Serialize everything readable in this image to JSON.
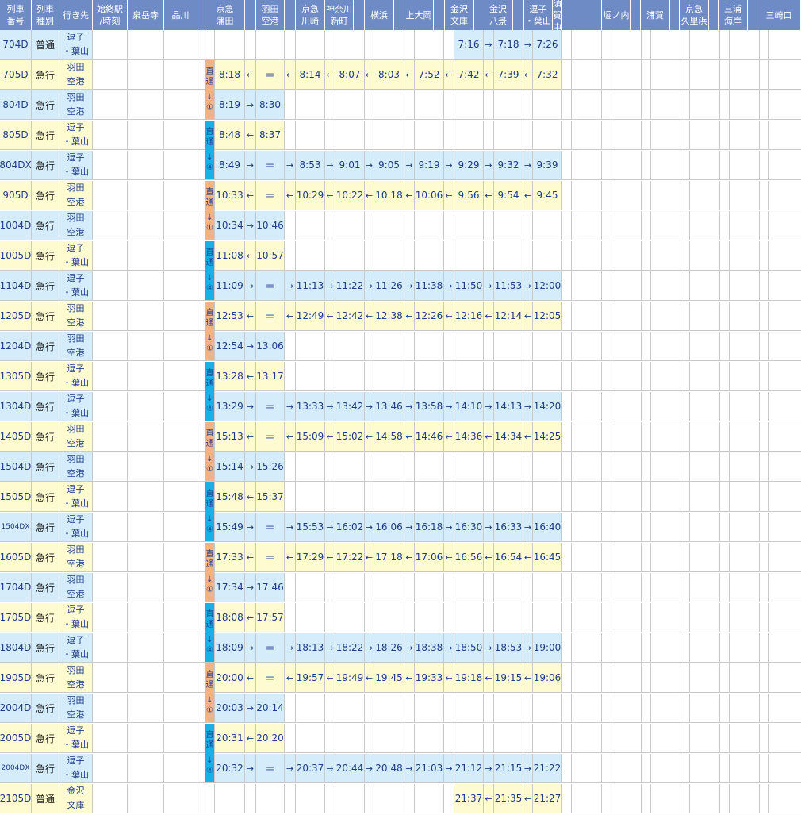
{
  "headers": [
    "列車\n番号",
    "列車\n種別",
    "行き先",
    "始終駅\n/時刻",
    "泉岳寺",
    "品川",
    "",
    "京急\n蒲田",
    "",
    "羽田\n空港",
    "",
    "京急\n川崎",
    "神奈川\n新町",
    "",
    "横浜",
    "",
    "上大岡",
    "",
    "金沢\n文庫",
    "",
    "金沢\n八景",
    "",
    "逗子\n・葉山",
    "横須賀\n中央",
    "",
    "堀ノ内",
    "",
    "浦賀",
    "",
    "京急\n久里浜",
    "",
    "三浦\n海岸",
    "",
    "三崎口"
  ],
  "through_labels": {
    "top": "直\n通",
    "bottom": "↓\n①",
    "bottom_alt": "↓\n④"
  },
  "equal_mark": "＝",
  "trains": [
    {
      "id": "704D",
      "kind": "普通",
      "dest": "逗子\n・葉山",
      "color": "blue",
      "times": {
        "kanazawa_bunko": "7:16",
        "a_kb_kh": "→",
        "kanazawa_hakkei": "7:18",
        "a_kh_zushi": "→",
        "zushi": "7:26"
      }
    },
    {
      "id": "705D",
      "kind": "急行",
      "dest": "羽田\n空港",
      "color": "yellow",
      "through": "top",
      "times": {
        "keikyu_kamata": "8:18",
        "a_kamata_haneda": "←",
        "haneda": "＝",
        "a_haneda_kawasaki": "←",
        "keikyu_kawasaki": "8:14",
        "a_kaw_kanagawa": "←",
        "kanagawa_shinmachi": "8:07",
        "a_kan_yoko": "←",
        "yokohama": "8:03",
        "a_yoko_kamiooka": "←",
        "kamiooka": "7:52",
        "a_kami_kb": "←",
        "kanazawa_bunko": "7:42",
        "a_kb_kh": "←",
        "kanazawa_hakkei": "7:39",
        "a_kh_zushi": "←",
        "zushi": "7:32"
      }
    },
    {
      "id": "804D",
      "kind": "急行",
      "dest": "羽田\n空港",
      "color": "blue",
      "times": {
        "keikyu_kamata": "8:19",
        "a_kamata_haneda": "→",
        "haneda": "8:30"
      }
    },
    {
      "id": "805D",
      "kind": "急行",
      "dest": "逗子\n・葉山",
      "color": "yellow",
      "through": "top",
      "times": {
        "keikyu_kamata": "8:48",
        "a_kamata_haneda": "←",
        "haneda": "8:37"
      }
    },
    {
      "id": "804DX",
      "kind": "急行",
      "dest": "逗子\n・葉山",
      "color": "blue",
      "times": {
        "keikyu_kamata": "8:49",
        "a_kamata_haneda": "→",
        "haneda": "＝",
        "a_haneda_kawasaki": "→",
        "keikyu_kawasaki": "8:53",
        "a_kaw_kanagawa": "→",
        "kanagawa_shinmachi": "9:01",
        "a_kan_yoko": "→",
        "yokohama": "9:05",
        "a_yoko_kamiooka": "→",
        "kamiooka": "9:19",
        "a_kami_kb": "→",
        "kanazawa_bunko": "9:29",
        "a_kb_kh": "→",
        "kanazawa_hakkei": "9:32",
        "a_kh_zushi": "→",
        "zushi": "9:39"
      }
    },
    {
      "id": "905D",
      "kind": "急行",
      "dest": "羽田\n空港",
      "color": "yellow",
      "through": "top",
      "times": {
        "keikyu_kamata": "10:33",
        "a_kamata_haneda": "←",
        "haneda": "＝",
        "a_haneda_kawasaki": "←",
        "keikyu_kawasaki": "10:29",
        "a_kaw_kanagawa": "←",
        "kanagawa_shinmachi": "10:22",
        "a_kan_yoko": "←",
        "yokohama": "10:18",
        "a_yoko_kamiooka": "←",
        "kamiooka": "10:06",
        "a_kami_kb": "←",
        "kanazawa_bunko": "9:56",
        "a_kb_kh": "←",
        "kanazawa_hakkei": "9:54",
        "a_kh_zushi": "←",
        "zushi": "9:45"
      }
    },
    {
      "id": "1004D",
      "kind": "急行",
      "dest": "羽田\n空港",
      "color": "blue",
      "times": {
        "keikyu_kamata": "10:34",
        "a_kamata_haneda": "→",
        "haneda": "10:46"
      }
    },
    {
      "id": "1005D",
      "kind": "急行",
      "dest": "逗子\n・葉山",
      "color": "yellow",
      "through": "top",
      "times": {
        "keikyu_kamata": "11:08",
        "a_kamata_haneda": "←",
        "haneda": "10:57"
      }
    },
    {
      "id": "1104D",
      "kind": "急行",
      "dest": "逗子\n・葉山",
      "color": "blue",
      "times": {
        "keikyu_kamata": "11:09",
        "a_kamata_haneda": "→",
        "haneda": "＝",
        "a_haneda_kawasaki": "→",
        "keikyu_kawasaki": "11:13",
        "a_kaw_kanagawa": "→",
        "kanagawa_shinmachi": "11:22",
        "a_kan_yoko": "→",
        "yokohama": "11:26",
        "a_yoko_kamiooka": "→",
        "kamiooka": "11:38",
        "a_kami_kb": "→",
        "kanazawa_bunko": "11:50",
        "a_kb_kh": "→",
        "kanazawa_hakkei": "11:53",
        "a_kh_zushi": "→",
        "zushi": "12:00"
      }
    },
    {
      "id": "1205D",
      "kind": "急行",
      "dest": "羽田\n空港",
      "color": "yellow",
      "through": "top",
      "times": {
        "keikyu_kamata": "12:53",
        "a_kamata_haneda": "←",
        "haneda": "＝",
        "a_haneda_kawasaki": "←",
        "keikyu_kawasaki": "12:49",
        "a_kaw_kanagawa": "←",
        "kanagawa_shinmachi": "12:42",
        "a_kan_yoko": "←",
        "yokohama": "12:38",
        "a_yoko_kamiooka": "←",
        "kamiooka": "12:26",
        "a_kami_kb": "←",
        "kanazawa_bunko": "12:16",
        "a_kb_kh": "←",
        "kanazawa_hakkei": "12:14",
        "a_kh_zushi": "←",
        "zushi": "12:05"
      }
    },
    {
      "id": "1204D",
      "kind": "急行",
      "dest": "羽田\n空港",
      "color": "blue",
      "times": {
        "keikyu_kamata": "12:54",
        "a_kamata_haneda": "→",
        "haneda": "13:06"
      }
    },
    {
      "id": "1305D",
      "kind": "急行",
      "dest": "逗子\n・葉山",
      "color": "yellow",
      "through": "top",
      "times": {
        "keikyu_kamata": "13:28",
        "a_kamata_haneda": "←",
        "haneda": "13:17"
      }
    },
    {
      "id": "1304D",
      "kind": "急行",
      "dest": "逗子\n・葉山",
      "color": "blue",
      "times": {
        "keikyu_kamata": "13:29",
        "a_kamata_haneda": "→",
        "haneda": "＝",
        "a_haneda_kawasaki": "→",
        "keikyu_kawasaki": "13:33",
        "a_kaw_kanagawa": "→",
        "kanagawa_shinmachi": "13:42",
        "a_kan_yoko": "→",
        "yokohama": "13:46",
        "a_yoko_kamiooka": "→",
        "kamiooka": "13:58",
        "a_kami_kb": "→",
        "kanazawa_bunko": "14:10",
        "a_kb_kh": "→",
        "kanazawa_hakkei": "14:13",
        "a_kh_zushi": "→",
        "zushi": "14:20"
      }
    },
    {
      "id": "1405D",
      "kind": "急行",
      "dest": "羽田\n空港",
      "color": "yellow",
      "through": "top",
      "times": {
        "keikyu_kamata": "15:13",
        "a_kamata_haneda": "←",
        "haneda": "＝",
        "a_haneda_kawasaki": "←",
        "keikyu_kawasaki": "15:09",
        "a_kaw_kanagawa": "←",
        "kanagawa_shinmachi": "15:02",
        "a_kan_yoko": "←",
        "yokohama": "14:58",
        "a_yoko_kamiooka": "←",
        "kamiooka": "14:46",
        "a_kami_kb": "←",
        "kanazawa_bunko": "14:36",
        "a_kb_kh": "←",
        "kanazawa_hakkei": "14:34",
        "a_kh_zushi": "←",
        "zushi": "14:25"
      }
    },
    {
      "id": "1504D",
      "kind": "急行",
      "dest": "羽田\n空港",
      "color": "blue",
      "times": {
        "keikyu_kamata": "15:14",
        "a_kamata_haneda": "→",
        "haneda": "15:26"
      }
    },
    {
      "id": "1505D",
      "kind": "急行",
      "dest": "逗子\n・葉山",
      "color": "yellow",
      "through": "top",
      "times": {
        "keikyu_kamata": "15:48",
        "a_kamata_haneda": "←",
        "haneda": "15:37"
      }
    },
    {
      "id": "1504DX",
      "kind": "急行",
      "dest": "逗子\n・葉山",
      "color": "blue",
      "small_id": true,
      "times": {
        "keikyu_kamata": "15:49",
        "a_kamata_haneda": "→",
        "haneda": "＝",
        "a_haneda_kawasaki": "→",
        "keikyu_kawasaki": "15:53",
        "a_kaw_kanagawa": "→",
        "kanagawa_shinmachi": "16:02",
        "a_kan_yoko": "→",
        "yokohama": "16:06",
        "a_yoko_kamiooka": "→",
        "kamiooka": "16:18",
        "a_kami_kb": "→",
        "kanazawa_bunko": "16:30",
        "a_kb_kh": "→",
        "kanazawa_hakkei": "16:33",
        "a_kh_zushi": "→",
        "zushi": "16:40"
      }
    },
    {
      "id": "1605D",
      "kind": "急行",
      "dest": "羽田\n空港",
      "color": "yellow",
      "through": "top",
      "times": {
        "keikyu_kamata": "17:33",
        "a_kamata_haneda": "←",
        "haneda": "＝",
        "a_haneda_kawasaki": "←",
        "keikyu_kawasaki": "17:29",
        "a_kaw_kanagawa": "←",
        "kanagawa_shinmachi": "17:22",
        "a_kan_yoko": "←",
        "yokohama": "17:18",
        "a_yoko_kamiooka": "←",
        "kamiooka": "17:06",
        "a_kami_kb": "←",
        "kanazawa_bunko": "16:56",
        "a_kb_kh": "←",
        "kanazawa_hakkei": "16:54",
        "a_kh_zushi": "←",
        "zushi": "16:45"
      }
    },
    {
      "id": "1704D",
      "kind": "急行",
      "dest": "羽田\n空港",
      "color": "blue",
      "times": {
        "keikyu_kamata": "17:34",
        "a_kamata_haneda": "→",
        "haneda": "17:46"
      }
    },
    {
      "id": "1705D",
      "kind": "急行",
      "dest": "逗子\n・葉山",
      "color": "yellow",
      "through": "top",
      "times": {
        "keikyu_kamata": "18:08",
        "a_kamata_haneda": "←",
        "haneda": "17:57"
      }
    },
    {
      "id": "1804D",
      "kind": "急行",
      "dest": "逗子\n・葉山",
      "color": "blue",
      "times": {
        "keikyu_kamata": "18:09",
        "a_kamata_haneda": "→",
        "haneda": "＝",
        "a_haneda_kawasaki": "→",
        "keikyu_kawasaki": "18:13",
        "a_kaw_kanagawa": "→",
        "kanagawa_shinmachi": "18:22",
        "a_kan_yoko": "→",
        "yokohama": "18:26",
        "a_yoko_kamiooka": "→",
        "kamiooka": "18:38",
        "a_kami_kb": "→",
        "kanazawa_bunko": "18:50",
        "a_kb_kh": "→",
        "kanazawa_hakkei": "18:53",
        "a_kh_zushi": "→",
        "zushi": "19:00"
      }
    },
    {
      "id": "1905D",
      "kind": "急行",
      "dest": "羽田\n空港",
      "color": "yellow",
      "through": "top",
      "times": {
        "keikyu_kamata": "20:00",
        "a_kamata_haneda": "←",
        "haneda": "＝",
        "a_haneda_kawasaki": "←",
        "keikyu_kawasaki": "19:57",
        "a_kaw_kanagawa": "←",
        "kanagawa_shinmachi": "19:49",
        "a_kan_yoko": "←",
        "yokohama": "19:45",
        "a_yoko_kamiooka": "←",
        "kamiooka": "19:33",
        "a_kami_kb": "←",
        "kanazawa_bunko": "19:18",
        "a_kb_kh": "←",
        "kanazawa_hakkei": "19:15",
        "a_kh_zushi": "←",
        "zushi": "19:06"
      }
    },
    {
      "id": "2004D",
      "kind": "急行",
      "dest": "羽田\n空港",
      "color": "blue",
      "times": {
        "keikyu_kamata": "20:03",
        "a_kamata_haneda": "→",
        "haneda": "20:14"
      }
    },
    {
      "id": "2005D",
      "kind": "急行",
      "dest": "逗子\n・葉山",
      "color": "yellow",
      "through": "top",
      "times": {
        "keikyu_kamata": "20:31",
        "a_kamata_haneda": "←",
        "haneda": "20:20"
      }
    },
    {
      "id": "2004DX",
      "kind": "急行",
      "dest": "逗子\n・葉山",
      "color": "blue",
      "small_id": true,
      "times": {
        "keikyu_kamata": "20:32",
        "a_kamata_haneda": "→",
        "haneda": "＝",
        "a_haneda_kawasaki": "→",
        "keikyu_kawasaki": "20:37",
        "a_kaw_kanagawa": "→",
        "kanagawa_shinmachi": "20:44",
        "a_kan_yoko": "→",
        "yokohama": "20:48",
        "a_yoko_kamiooka": "→",
        "kamiooka": "21:03",
        "a_kami_kb": "→",
        "kanazawa_bunko": "21:12",
        "a_kb_kh": "→",
        "kanazawa_hakkei": "21:15",
        "a_kh_zushi": "→",
        "zushi": "21:22"
      }
    },
    {
      "id": "2105D",
      "kind": "普通",
      "dest": "金沢\n文庫",
      "color": "yellow",
      "times": {
        "kanazawa_bunko": "21:37",
        "a_kb_kh": "←",
        "kanazawa_hakkei": "21:35",
        "a_kh_zushi": "←",
        "zushi": "21:27"
      }
    }
  ],
  "through_pairs": [
    {
      "top_row": 1,
      "style": "orange",
      "bottom": "bottom"
    },
    {
      "top_row": 3,
      "style": "blue",
      "bottom": "bottom_alt"
    },
    {
      "top_row": 5,
      "style": "orange",
      "bottom": "bottom"
    },
    {
      "top_row": 7,
      "style": "blue",
      "bottom": "bottom_alt"
    },
    {
      "top_row": 9,
      "style": "orange",
      "bottom": "bottom"
    },
    {
      "top_row": 11,
      "style": "blue",
      "bottom": "bottom_alt"
    },
    {
      "top_row": 13,
      "style": "orange",
      "bottom": "bottom"
    },
    {
      "top_row": 15,
      "style": "blue",
      "bottom": "bottom_alt"
    },
    {
      "top_row": 17,
      "style": "orange",
      "bottom": "bottom"
    },
    {
      "top_row": 19,
      "style": "blue",
      "bottom": "bottom_alt"
    },
    {
      "top_row": 21,
      "style": "orange",
      "bottom": "bottom"
    },
    {
      "top_row": 23,
      "style": "blue",
      "bottom": "bottom_alt"
    }
  ],
  "colors": {
    "header_bg": "#6f8bc6",
    "row_blue": "#d5ecfb",
    "row_yellow": "#fffbd0",
    "through_orange": "#f3b286",
    "through_blue": "#19b0e6",
    "text_blue": "#1d3c8c"
  }
}
